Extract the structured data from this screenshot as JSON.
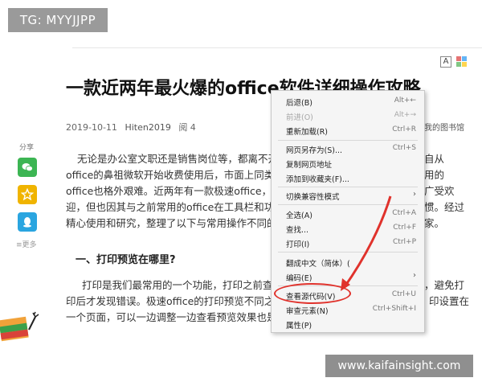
{
  "watermark": {
    "tag": "TG: MYYJJPP",
    "url": "www.kaifainsight.com"
  },
  "toolbar": {
    "font_letter": "A",
    "grid_colors": [
      "#e57373",
      "#64b5f6",
      "#81c784",
      "#ffd54f"
    ]
  },
  "article": {
    "title": "一款近两年最火爆的office软件详细操作攻略",
    "date": "2019-10-11",
    "author": "Hiten2019",
    "reads": "阅 4",
    "save_to_library": "我的图书馆",
    "paragraph1": [
      "无论是办公室文职还是销售岗位等，都离不开",
      "office的鼻祖微软开始收费使用后，市面上同类",
      "office也格外艰难。近两年有一款极速office，E",
      "迎，但也因其与之前常用的office在工具栏和功",
      "精心使用和研究，整理了以下与常用操作不同的"
    ],
    "paragraph1_right": [
      "自从",
      "用的",
      "广受欢",
      "惯。经过",
      "家。"
    ],
    "heading1": "一、打印预览在哪里?",
    "paragraph2": [
      "打印是我们最常用的一个功能，打印之前查",
      "印后才发现错误。极速office的打印预览不同之",
      "一个页面，可以一边调整一边查看预览效果也是"
    ],
    "paragraph2_right": [
      "，避免打",
      "印设置在",
      ""
    ]
  },
  "share": {
    "label": "分享",
    "more": "≡更多",
    "wechat_color": "#3cb553",
    "star_color": "#f0b400",
    "qq_color": "#2aa5e0"
  },
  "context_menu": {
    "items": [
      {
        "label": "后退(B)",
        "shortcut": "Alt+←",
        "disabled": false
      },
      {
        "label": "前进(O)",
        "shortcut": "Alt+→",
        "disabled": true
      },
      {
        "label": "重新加载(R)",
        "shortcut": "Ctrl+R",
        "disabled": false
      },
      {
        "label": "网页另存为(S)...",
        "shortcut": "Ctrl+S",
        "disabled": false
      },
      {
        "label": "复制网页地址",
        "shortcut": "",
        "disabled": false
      },
      {
        "label": "添加到收藏夹(F)...",
        "shortcut": "",
        "disabled": false
      },
      {
        "label": "切换兼容性模式",
        "shortcut": "",
        "disabled": false,
        "submenu": "›"
      },
      {
        "label": "全选(A)",
        "shortcut": "Ctrl+A",
        "disabled": false
      },
      {
        "label": "查找...",
        "shortcut": "Ctrl+F",
        "disabled": false
      },
      {
        "label": "打印(I)",
        "shortcut": "Ctrl+P",
        "disabled": false
      },
      {
        "label": "翻成中文（简体）(",
        "shortcut": "",
        "disabled": false
      },
      {
        "label": "编码(E)",
        "shortcut": "",
        "disabled": false,
        "submenu": "›"
      },
      {
        "label": "查看源代码(V)",
        "shortcut": "Ctrl+U",
        "disabled": false
      },
      {
        "label": "审查元素(N)",
        "shortcut": "Ctrl+Shift+I",
        "disabled": false
      },
      {
        "label": "属性(P)",
        "shortcut": "",
        "disabled": false
      }
    ],
    "highlight_color": "#e0322c"
  }
}
